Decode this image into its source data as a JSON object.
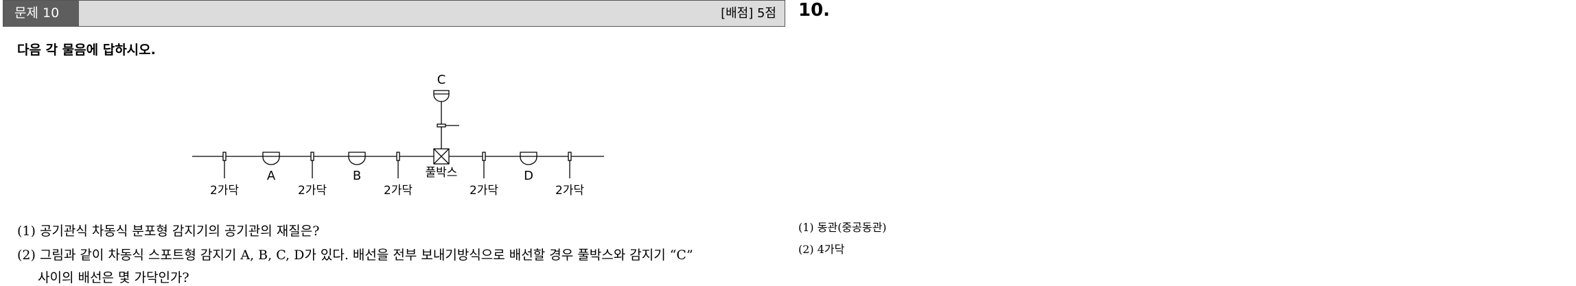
{
  "header": {
    "label": "문제 10",
    "score": "[배점] 5점"
  },
  "answer_number": "10.",
  "instruction": "다음 각 물음에 답하시오.",
  "diagram": {
    "top_label": "C",
    "main_labels": [
      "A",
      "B",
      "D"
    ],
    "pullbox_label": "풀박스",
    "wire_label": "2가닥"
  },
  "questions": [
    {
      "text": "(1) 공기관식 차동식 분포형 감지기의 공기관의 재질은?"
    },
    {
      "text": "(2) 그림과 같이 차동식 스포트형 감지기 A, B, C, D가 있다. 배선을 전부 보내기방식으로 배선할 경우 풀박스와 감지기 “C”",
      "cont": "사이의 배선은 몇 가닥인가?"
    }
  ],
  "answers": [
    "(1) 동관(중공동관)",
    "(2) 4가닥"
  ]
}
